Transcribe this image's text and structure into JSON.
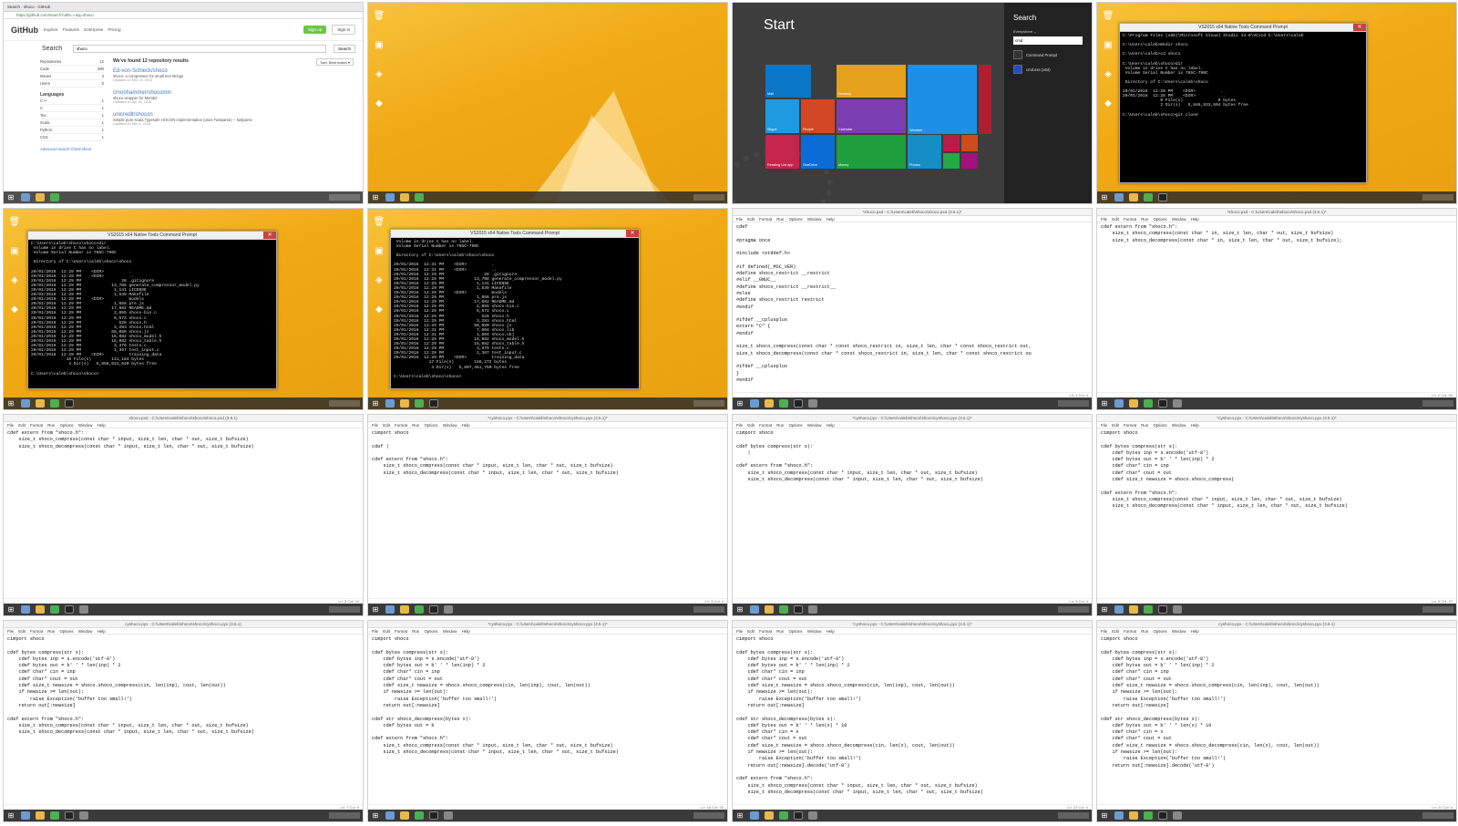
{
  "tile1": {
    "tab": "Search · shoco · GitHub",
    "url": "https://github.com/search?utf8=✓&q=shoco",
    "logo": "GitHub",
    "nav": "Explore Features Enterprise Pricing",
    "signup": "Sign up",
    "signin": "Sign in",
    "search_label": "Search",
    "search_value": "shoco",
    "search_button": "Search",
    "found": "We've found 12 repository results",
    "sort": "Sort: Best match ▾",
    "side_items": [
      {
        "label": "Repositories",
        "count": "12"
      },
      {
        "label": "Code",
        "count": "380"
      },
      {
        "label": "Issues",
        "count": "3"
      },
      {
        "label": "Users",
        "count": "0"
      }
    ],
    "languages_heading": "Languages",
    "languages": [
      {
        "label": "C++",
        "count": "1"
      },
      {
        "label": "C",
        "count": "1"
      },
      {
        "label": "Tex",
        "count": "1"
      },
      {
        "label": "Scala",
        "count": "1"
      },
      {
        "label": "Python",
        "count": "1"
      },
      {
        "label": "CSS",
        "count": "1"
      }
    ],
    "adv": "Advanced search   Cheat sheet",
    "results": [
      {
        "name": "Ed-von-Schleck/shoco",
        "desc": "shoco: a compressor for small text strings",
        "updated": "Updated on Dec 21, 2015"
      },
      {
        "name": "cmonhammer/shocomin",
        "desc": "shoco wrapper for Mendel",
        "updated": "Updated on Apr 30, 2015"
      },
      {
        "name": "unicredit/shocon",
        "desc": "Simple pure-scala Typesafe HOCON implementation (uses Fastparse) -- fastparse",
        "updated": "Updated on Dec 1, 2015"
      }
    ]
  },
  "tile3": {
    "title": "Start",
    "search_heading": "Search",
    "scope": "Everywhere ⌄",
    "query": "cmd",
    "results": [
      "Command Prompt",
      "cmd.exe (x64)"
    ],
    "tiles": [
      "Mail",
      "Desktop",
      "Weather",
      "News",
      "Skype",
      "People",
      "Calendar",
      "Reading List app",
      "OneDrive",
      "Money",
      "Photos"
    ]
  },
  "tile4": {
    "title": "VS2015 x64 Native Tools Command Prompt",
    "lines": [
      "C:\\Program Files (x86)\\Microsoft Visual Studio 14.0\\VC>cd C:\\Users\\caleb",
      "",
      "C:\\Users\\caleb>mkdir shoco",
      "",
      "C:\\Users\\caleb>cd shoco",
      "",
      "C:\\Users\\caleb\\shoco>dir",
      " Volume in drive C has no label.",
      " Volume Serial Number is 765C-790C",
      "",
      " Directory of C:\\Users\\caleb\\shoco",
      "",
      "20/01/2016  12:28 PM    <DIR>          .",
      "20/01/2016  12:28 PM    <DIR>          ..",
      "               0 File(s)              0 bytes",
      "               2 Dir(s)   5,846,933,504 bytes free",
      "",
      "C:\\Users\\caleb\\shoco>git clone"
    ]
  },
  "tile5": {
    "title": "VS2015 x64 Native Tools Command Prompt",
    "lines": [
      "C:\\Users\\caleb\\shoco\\shoco>dir",
      " Volume in drive C has no label.",
      " Volume Serial Number is 765C-790C",
      "",
      " Directory of C:\\Users\\caleb\\shoco\\shoco",
      "",
      "20/01/2016  12:29 PM    <DIR>          .",
      "20/01/2016  12:29 PM    <DIR>          ..",
      "20/01/2016  12:29 PM                28 .gitignore",
      "20/01/2016  12:29 PM            13,708 generate_compressor_model.py",
      "20/01/2016  12:29 PM             1,141 LICENSE",
      "20/01/2016  12:29 PM             1,539 Makefile",
      "20/01/2016  12:29 PM    <DIR>          models",
      "20/01/2016  12:29 PM             1,658 pre.js",
      "20/01/2016  12:29 PM            17,682 README.md",
      "20/01/2016  12:29 PM             2,055 shoco-bin.c",
      "20/01/2016  12:29 PM             6,572 shoco.c",
      "20/01/2016  12:29 PM               528 shoco.h",
      "20/01/2016  12:29 PM             3,283 shoco.html",
      "20/01/2016  12:29 PM            58,080 shoco.js",
      "20/01/2016  12:29 PM            16,082 shoco_model.h",
      "20/01/2016  12:29 PM            16,082 shoco_table.h",
      "20/01/2016  12:29 PM             3,379 tests.c",
      "20/01/2016  12:29 PM             1,367 test_input.c",
      "20/01/2016  12:29 PM    <DIR>          training_data",
      "              15 File(s)        141,184 bytes",
      "               4 Dir(s)   5,858,624,640 bytes free",
      "",
      "C:\\Users\\caleb\\shoco\\shoco>"
    ]
  },
  "tile6": {
    "title": "VS2015 x64 Native Tools Command Prompt",
    "lines": [
      " Volume in drive C has no label.",
      " Volume Serial Number is 765C-790C",
      "",
      " Directory of C:\\Users\\caleb\\shoco\\shoco",
      "",
      "20/01/2016  12:31 PM    <DIR>          .",
      "20/01/2016  12:31 PM    <DIR>          ..",
      "20/01/2016  12:29 PM                28 .gitignore",
      "20/01/2016  12:29 PM            13,708 generate_compressor_model.py",
      "20/01/2016  12:29 PM             1,141 LICENSE",
      "20/01/2016  12:29 PM             1,539 Makefile",
      "20/01/2016  12:29 PM    <DIR>          models",
      "20/01/2016  12:29 PM             1,658 pre.js",
      "20/01/2016  12:29 PM            17,682 README.md",
      "20/01/2016  12:29 PM             2,055 shoco-bin.c",
      "20/01/2016  12:29 PM             6,572 shoco.c",
      "20/01/2016  12:29 PM               528 shoco.h",
      "20/01/2016  12:29 PM             3,283 shoco.html",
      "20/01/2016  12:29 PM            58,080 shoco.js",
      "20/01/2016  12:31 PM             7,604 shoco.lib",
      "20/01/2016  12:31 PM             1,604 shoco.obj",
      "20/01/2016  12:29 PM            16,082 shoco_model.h",
      "20/01/2016  12:29 PM            16,082 shoco_table.h",
      "20/01/2016  12:29 PM             3,379 tests.c",
      "20/01/2016  12:29 PM             1,367 test_input.c",
      "20/01/2016  12:29 PM    <DIR>          training_data",
      "              17 File(s)        156,272 bytes",
      "               4 Dir(s)   5,897,461,760 bytes free",
      "",
      "C:\\Users\\caleb\\shoco\\shoco>"
    ]
  },
  "editors": [
    {
      "title": "*shoco.pxd - C:\\Users\\caleb\\shoco\\shoco.pxd (3.5.1)*",
      "status": "Ln: 1  Col: 4",
      "code": "cdef\n\n#pragma once\n\n#include <stddef.h>\n\n#if defined(_MSC_VER)\n#define shoco_restrict __restrict\n#elif __GNUC__\n#define shoco_restrict __restrict__\n#else\n#define shoco_restrict restrict\n#endif\n\n#ifdef __cplusplus\nextern \"C\" {\n#endif\n\nsize_t shoco_compress(const char * const shoco_restrict in, size_t len, char * const shoco_restrict out,\nsize_t shoco_decompress(const char * const shoco_restrict in, size_t len, char * const shoco_restrict ou\n\n#ifdef __cplusplus\n}\n#endif"
    },
    {
      "title": "*shoco.pxd - C:\\Users\\caleb\\shoco\\shoco.pxd (3.5.1)*",
      "status": "Ln: 2  Col: 90",
      "code": "cdef extern from \"shoco.h\":\n    size_t shoco_compress(const char * in, size_t len, char * out, size_t bufsize)\n    size_t shoco_decompress(const char * in, size_t len, char * out, size_t bufsize);"
    },
    {
      "title": "shoco.pxd - C:\\Users\\caleb\\shoco\\shoco\\shoco.pxd (3.5.1)",
      "status": "Ln: 3  Col: 44",
      "code": "cdef extern from \"shoco.h\":\n    size_t shoco_compress(const char * input, size_t len, char * out, size_t bufsize)\n    size_t shoco_decompress(const char * input, size_t len, char * out, size_t bufsize)"
    },
    {
      "title": "*cyshoco.pyx - C:\\Users\\caleb\\shoco\\shoco\\cyshoco.pyx (3.5.1)*",
      "status": "Ln: 3  Col: 4",
      "code": "cimport shoco\n\ncdef |\n\ncdef extern from \"shoco.h\":\n    size_t shoco_compress(const char * input, size_t len, char * out, size_t bufsize)\n    size_t shoco_decompress(const char * input, size_t len, char * out, size_t bufsize)"
    },
    {
      "title": "*cyshoco.pyx - C:\\Users\\caleb\\shoco\\shoco\\cyshoco.pyx (3.5.1)*",
      "status": "Ln: 5  Col: 4",
      "code": "cimport shoco\n\ncdef bytes compress(str s):\n    |\n\ncdef extern from \"shoco.h\":\n    size_t shoco_compress(const char * input, size_t len, char * out, size_t bufsize)\n    size_t shoco_decompress(const char * input, size_t len, char * out, size_t bufsize)"
    },
    {
      "title": "*cyshoco.pyx - C:\\Users\\caleb\\shoco\\shoco\\cyshoco.pyx (3.5.1)*",
      "status": "Ln: 9  Col: 47",
      "code": "cimport shoco\n\ncdef bytes compress(str s):\n    cdef bytes inp = s.encode('utf-8')\n    cdef bytes out = b' ' * len(inp) * 2\n    cdef char* cin = inp\n    cdef char* cout = out\n    cdef size_t newsize = shoco.shoco_compress(\n\ncdef extern from \"shoco.h\":\n    size_t shoco_compress(const char * input, size_t len, char * out, size_t bufsize)\n    size_t shoco_decompress(const char * input, size_t len, char * out, size_t bufsize)"
    },
    {
      "title": "cyshoco.pyx - C:\\Users\\caleb\\shoco\\shoco\\cyshoco.pyx (3.5.1)",
      "status": "Ln: 7  Col: 9",
      "code": "cimport shoco\n\ncdef bytes compress(str s):\n    cdef bytes inp = s.encode('utf-8')\n    cdef bytes out = b' ' * len(inp) * 2\n    cdef char* cin = inp\n    cdef char* cout = out\n    cdef size_t newsize = shoco.shoco_compress(cin, len(inp), cout, len(out))\n    if newsize >= len(out):\n        raise Exception('buffer too small!')\n    return out[:newsize]\n\ncdef extern from \"shoco.h\":\n    size_t shoco_compress(const char * input, size_t len, char * out, size_t bufsize)\n    size_t shoco_decompress(const char * input, size_t len, char * out, size_t bufsize)"
    },
    {
      "title": "*cyshoco.pyx - C:\\Users\\caleb\\shoco\\shoco\\cyshoco.pyx (3.5.1)*",
      "status": "Ln: 16  Col: 20",
      "code": "cimport shoco\n\ncdef bytes compress(str s):\n    cdef bytes inp = s.encode('utf-8')\n    cdef bytes out = b' ' * len(inp) * 2\n    cdef char* cin = inp\n    cdef char* cout = out\n    cdef size_t newsize = shoco.shoco_compress(cin, len(inp), cout, len(out))\n    if newsize >= len(out):\n        raise Exception('buffer too small!')\n    return out[:newsize]\n\ncdef str shoco_decompress(bytes x):\n    cdef bytes out = b\n\ncdef extern from \"shoco.h\":\n    size_t shoco_compress(const char * input, size_t len, char * out, size_t bufsize)\n    size_t shoco_decompress(const char * input, size_t len, char * out, size_t bufsize)"
    },
    {
      "title": "*cyshoco.pyx - C:\\Users\\caleb\\shoco\\shoco\\cyshoco.pyx (3.5.1)*",
      "status": "Ln: 23  Col: 0",
      "code": "cimport shoco\n\ncdef bytes compress(str s):\n    cdef bytes inp = s.encode('utf-8')\n    cdef bytes out = b' ' * len(inp) * 2\n    cdef char* cin = inp\n    cdef char* cout = out\n    cdef size_t newsize = shoco.shoco_compress(cin, len(inp), cout, len(out))\n    if newsize >= len(out):\n        raise Exception('buffer too small!')\n    return out[:newsize]\n\ncdef str shoco_decompress(bytes x):\n    cdef bytes out = b' ' * len(x) * 10\n    cdef char* cin = x\n    cdef char* cout = out\n    cdef size_t newsize = shoco.shoco_decompress(cin, len(x), cout, len(out))\n    if newsize >= len(out):\n        raise Exception('buffer too small!')\n    return out[:newsize].decode('utf-8')\n\ncdef extern from \"shoco.h\":\n    size_t shoco_compress(const char * input, size_t len, char * out, size_t bufsize)\n    size_t shoco_decompress(const char * input, size_t len, char * out, size_t bufsize)"
    },
    {
      "title": "cyshoco.pyx - C:\\Users\\caleb\\shoco\\shoco\\cyshoco.pyx (3.5.1)",
      "status": "Ln: 21  Col: 4",
      "code": "cimport shoco\n\ncdef bytes compress(str s):\n    cdef bytes inp = s.encode('utf-8')\n    cdef bytes out = b' ' * len(inp) * 2\n    cdef char* cin = inp\n    cdef char* cout = out\n    cdef size_t newsize = shoco.shoco_compress(cin, len(inp), cout, len(out))\n    if newsize >= len(out):\n        raise Exception('buffer too small!')\n    return out[:newsize]\n\ncdef str shoco_decompress(bytes x):\n    cdef bytes out = b' ' * len(x) * 10\n    cdef char* cin = x\n    cdef char* cout = out\n    cdef size_t newsize = shoco.shoco_decompress(cin, len(x), cout, len(out))\n    if newsize >= len(out):\n        raise Exception('buffer too small!')\n    return out[:newsize].decode('utf-8')"
    }
  ],
  "menu": "File Edit Format Run Options Window Help",
  "desktop_icons": [
    "Recycle Bin",
    "Scratch",
    "Recycle Bin",
    "Visual Studio"
  ]
}
